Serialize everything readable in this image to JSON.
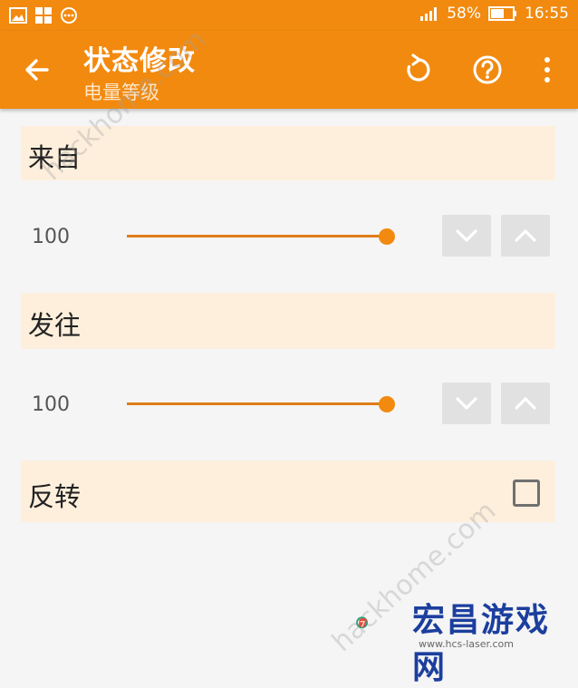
{
  "status_bar": {
    "battery": "58%",
    "time": "16:55"
  },
  "app_bar": {
    "title": "状态修改",
    "subtitle": "电量等级"
  },
  "sections": {
    "from": {
      "label": "来自",
      "value": "100",
      "slider_fraction": 1.0
    },
    "to": {
      "label": "发往",
      "value": "100",
      "slider_fraction": 1.0
    },
    "invert": {
      "label": "反转",
      "checked": false
    }
  },
  "watermark": {
    "text": "hackhome.com"
  },
  "brand": {
    "name": "宏昌游戏网",
    "url": "www.hcs-laser.com"
  },
  "colors": {
    "accent": "#f28a0f",
    "section_bg": "#fdefdc",
    "page_bg": "#f5f5f5"
  }
}
